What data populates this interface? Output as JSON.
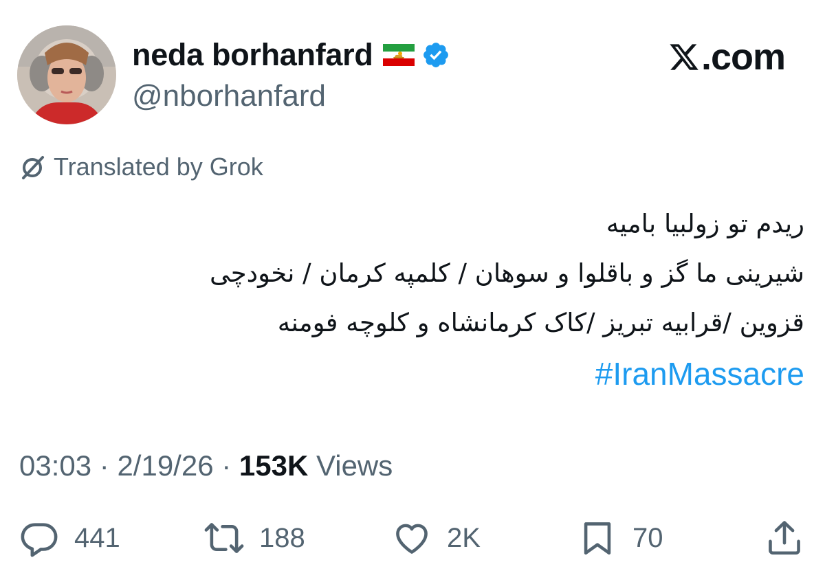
{
  "user": {
    "display_name": "neda borhanfard",
    "handle": "@nborhanfard",
    "flag": "iran-lion-and-sun-flag-icon",
    "verified": true
  },
  "site": {
    "logo": "x-logo-icon",
    "label": ".com"
  },
  "translation": {
    "label": "Translated by Grok",
    "icon": "grok-icon"
  },
  "tweet": {
    "lines": [
      "ریدم تو زولبیا بامیه",
      "شیرینی ما گز و باقلوا و سوهان / کلمپه کرمان / نخودچی",
      "قزوین /قرابیه تبریز /کاک کرمانشاه و کلوچه فومنه"
    ],
    "hashtag": "#IranMassacre"
  },
  "meta": {
    "time": "03:03",
    "date": "2/19/26",
    "separator": " · ",
    "views_count": "153K",
    "views_label": " Views"
  },
  "actions": {
    "replies": "441",
    "reposts": "188",
    "likes": "2K",
    "bookmarks": "70"
  },
  "colors": {
    "link": "#1d9bf0",
    "secondary_text": "#536471",
    "primary_text": "#0f1419",
    "verified": "#1d9bf0"
  }
}
